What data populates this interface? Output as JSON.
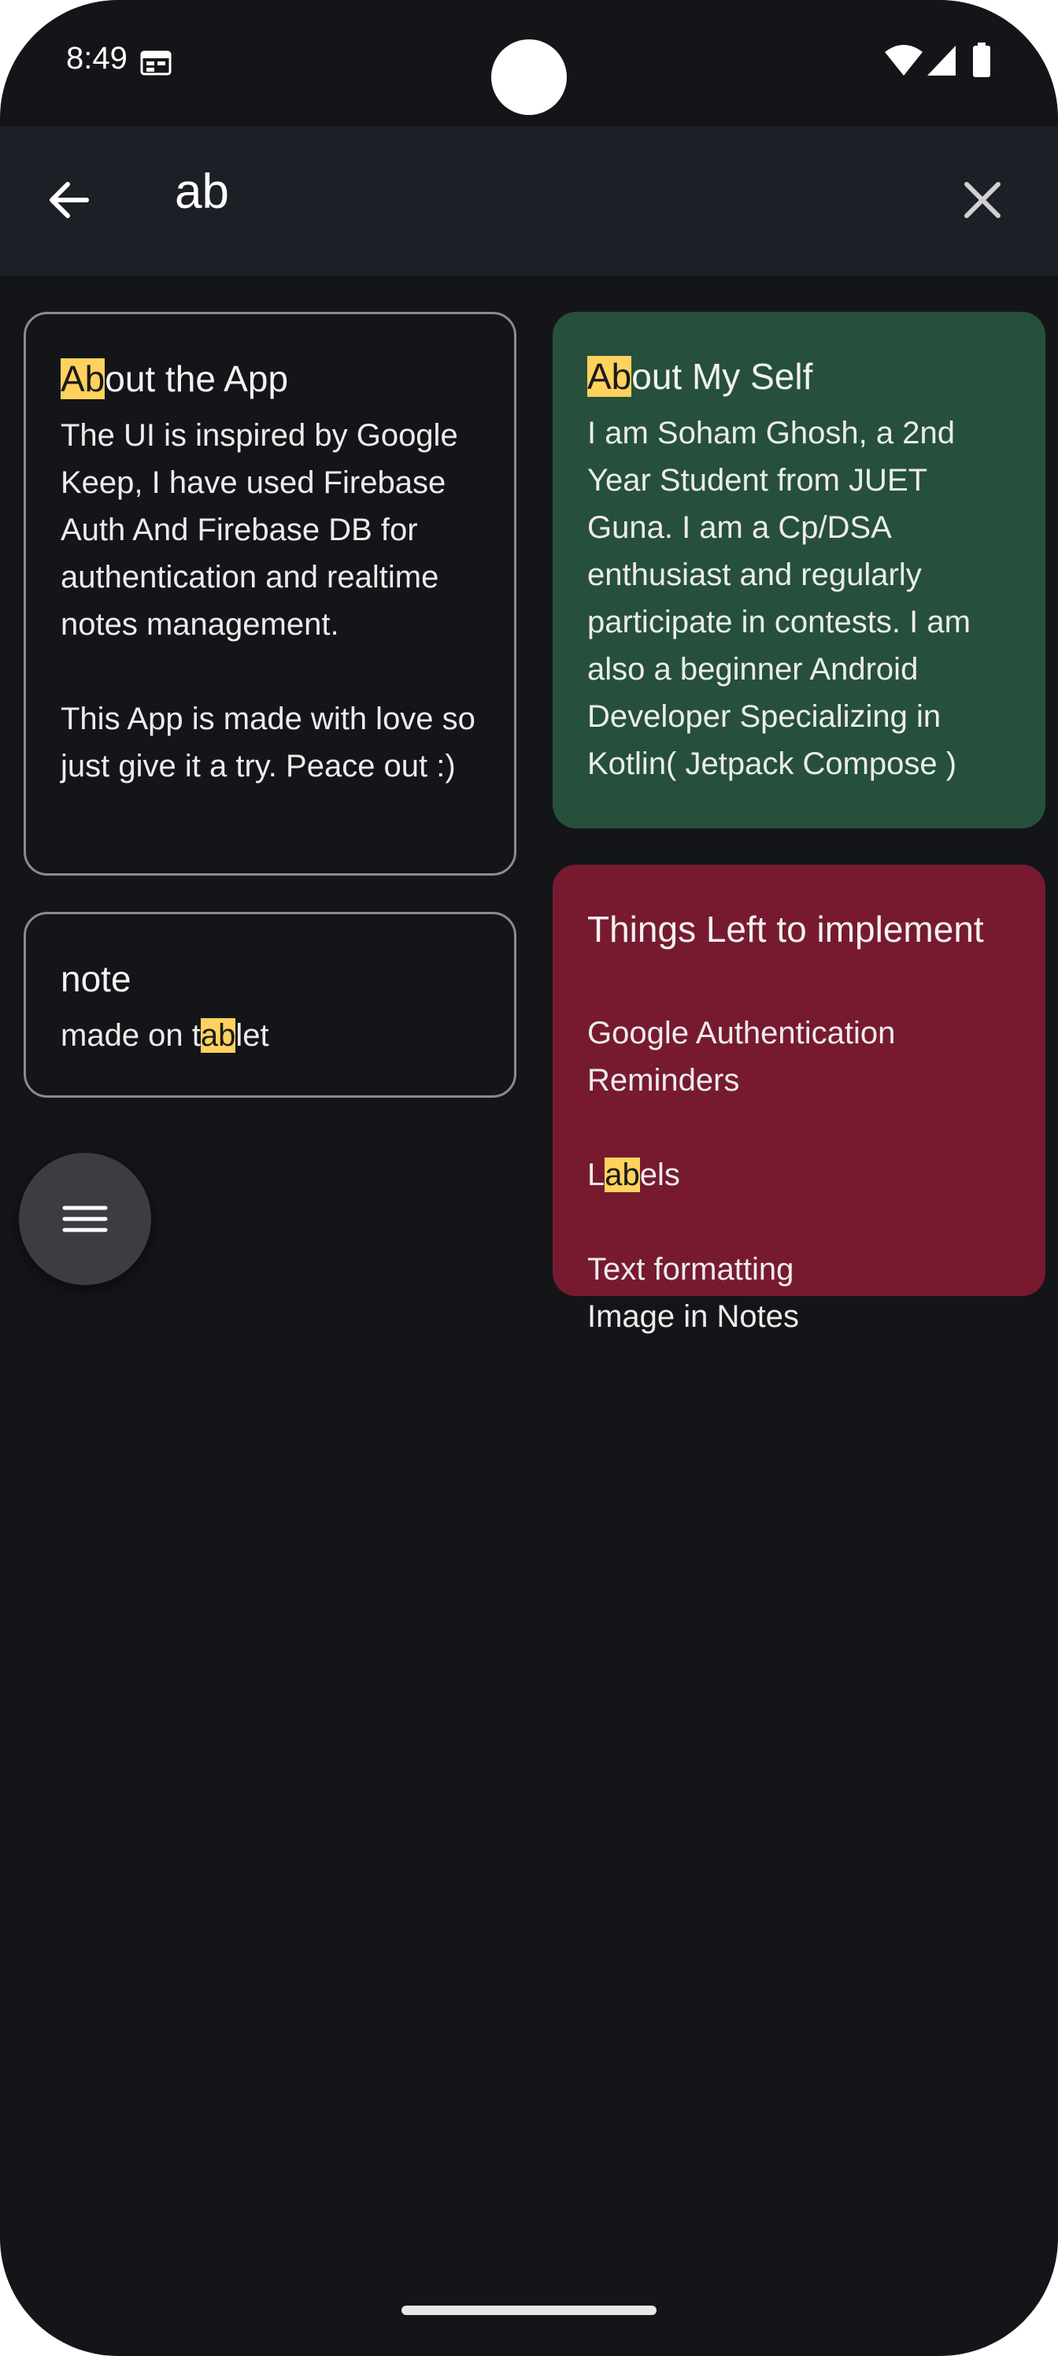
{
  "status_bar": {
    "time": "8:49"
  },
  "search": {
    "query": "ab"
  },
  "notes": [
    {
      "title_parts": [
        "Ab",
        "out the App"
      ],
      "body": "The UI is inspired by Google Keep, I have used Firebase Auth And Firebase DB for authentication and realtime notes management.\n\nThis App is made with love so just give it a try. Peace out :)",
      "style": "outlined"
    },
    {
      "title_parts": [
        "Ab",
        "out My Self"
      ],
      "body": "I am Soham Ghosh, a 2nd Year Student from JUET Guna. I am a Cp/DSA enthusiast and regularly participate in contests. I am also a beginner Android Developer Specializing in Kotlin( Jetpack Compose )",
      "color": "#26503b"
    },
    {
      "title": "note",
      "body_parts": [
        "made on t",
        "ab",
        "let"
      ],
      "style": "outlined"
    },
    {
      "title": "Things Left to implement",
      "body_before": "Google Authentication\nReminders",
      "label_parts": [
        "L",
        "ab",
        "els"
      ],
      "body_after": "Text formatting\nImage in Notes",
      "color": "#771a30"
    }
  ],
  "colors": {
    "background": "#141518",
    "top_bar": "#1c1f25",
    "highlight": "#ffd25e"
  },
  "icons": [
    "calendar-icon",
    "wifi-icon",
    "signal-icon",
    "battery-icon",
    "arrow-back-icon",
    "close-icon",
    "menu-icon"
  ]
}
